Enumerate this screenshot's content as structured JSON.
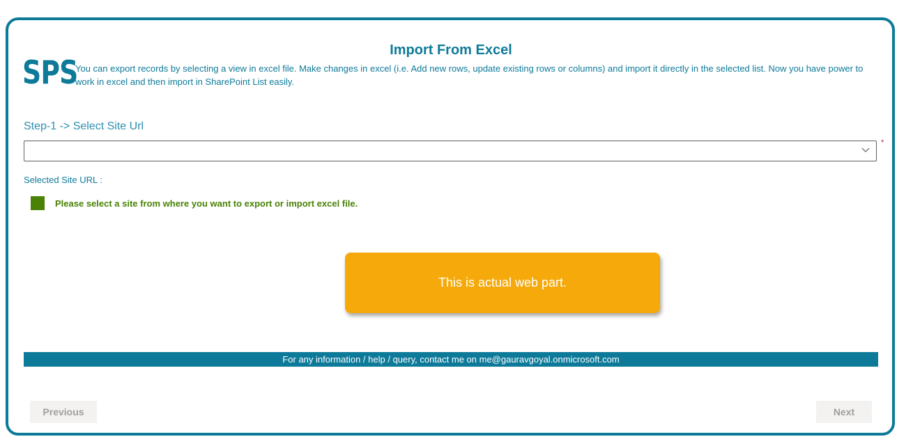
{
  "header": {
    "title": "Import From Excel",
    "logo_text": "SPS",
    "description": "You can export records by selecting a view in excel file. Make changes in excel (i.e. Add new rows, update existing rows or columns) and import it directly in the selected list. Now you have power to work in excel and then import in SharePoint List easily."
  },
  "step1": {
    "label": "Step-1 -> Select Site Url",
    "select_value": "",
    "required_mark": "*",
    "selected_url_label": "Selected Site URL :",
    "status_message": "Please select a site from where you want to export or import excel file."
  },
  "callout": {
    "text": "This is actual web part."
  },
  "footer": {
    "contact_text": "For any information / help / query, contact me on me@gauravgoyal.onmicrosoft.com"
  },
  "navigation": {
    "previous_label": "Previous",
    "next_label": "Next"
  },
  "colors": {
    "accent": "#0e7a99",
    "success": "#498205",
    "callout": "#f5a90b",
    "required": "#a4262c"
  },
  "icons": {
    "dropdown": "chevron-down-icon",
    "status": "status-square-icon"
  }
}
